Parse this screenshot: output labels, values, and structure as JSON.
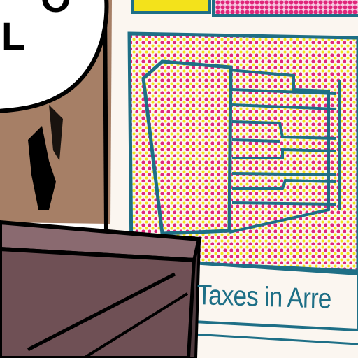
{
  "scene": {
    "sign_label": "Taxes in Arre",
    "bubble_lines": [
      "O",
      "L"
    ],
    "colors": {
      "teal": "#1e6f86",
      "magenta": "#e0267a",
      "yellow": "#f3e21b",
      "paper": "#fbf6f0",
      "wall": "#a67f66",
      "desk": "#6f5055",
      "ink": "#000000"
    }
  }
}
